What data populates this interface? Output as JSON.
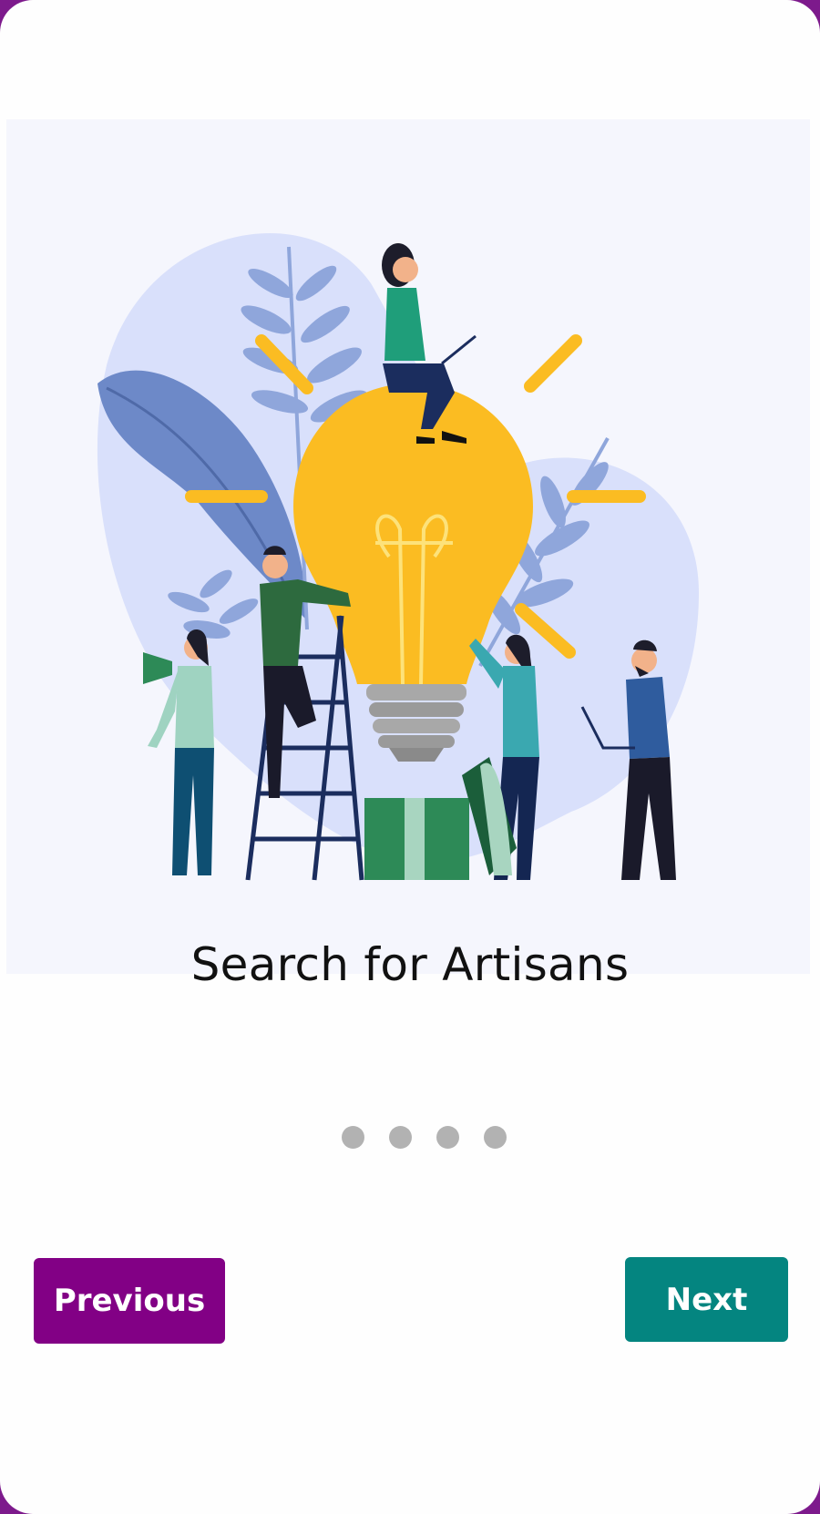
{
  "slide": {
    "title": "Search for Artisans",
    "illustration_icon": "lightbulb-teamwork-illustration"
  },
  "pager": {
    "total": 4,
    "active_index": 0
  },
  "buttons": {
    "previous_label": "Previous",
    "next_label": "Next"
  },
  "colors": {
    "frame": "#7d1a8c",
    "previous_button": "#820085",
    "next_button": "#048580",
    "dot": "#b2b2b2",
    "bulb": "#fbbc22",
    "blob": "#d9e0fb",
    "leaf": "#6d89c8"
  }
}
